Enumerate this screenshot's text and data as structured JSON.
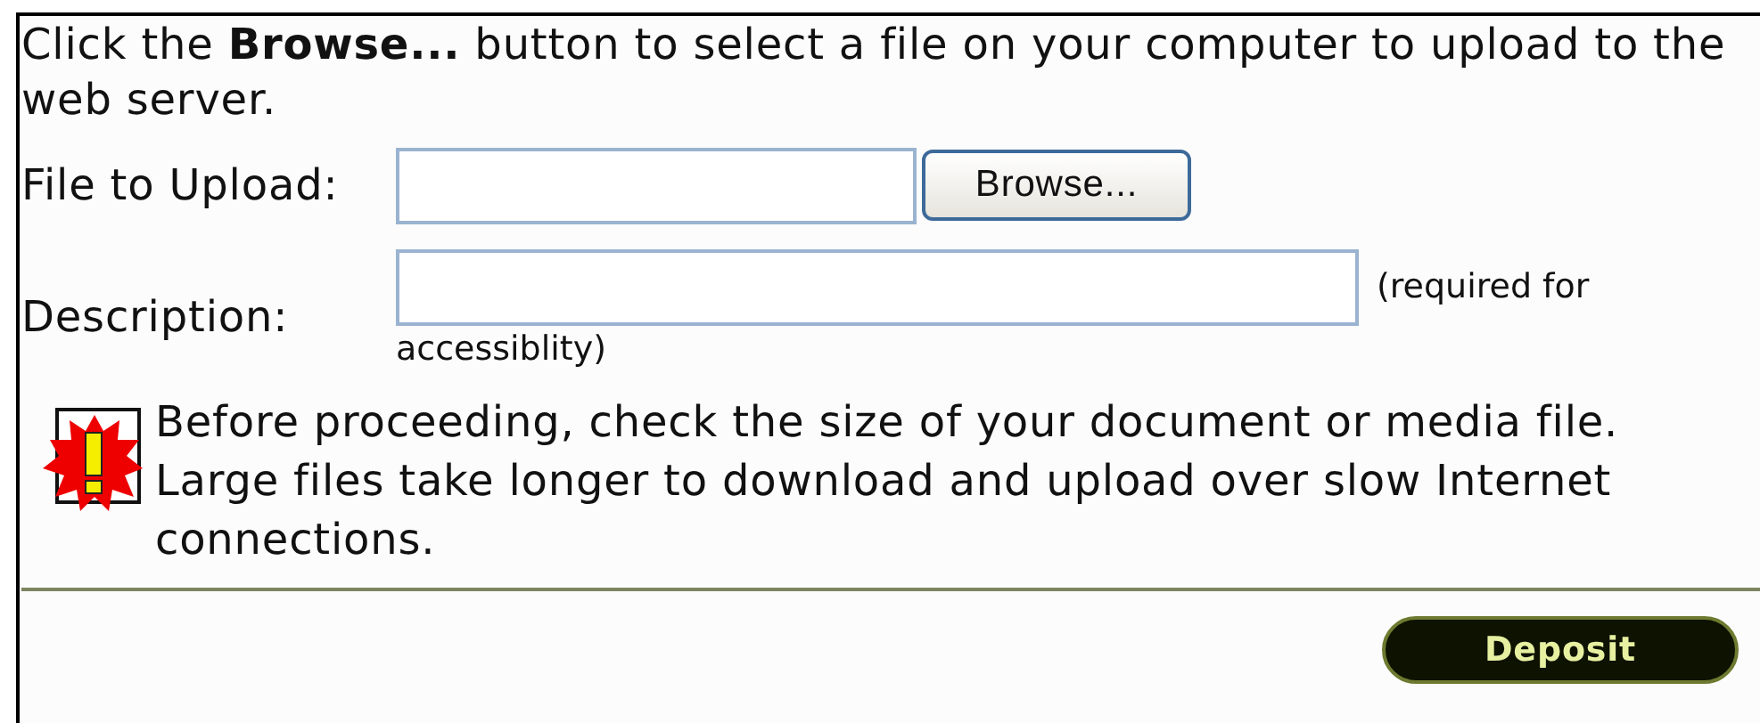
{
  "intro": "Click the **Browse...** button to select a file on your computer to upload to the web server.",
  "file_field": {
    "label": "File to Upload:",
    "browse_button": "Browse..."
  },
  "description_field": {
    "label": "Description:",
    "note_lines": [
      "(required for",
      "accessiblity)"
    ]
  },
  "warning": {
    "text": "Before proceeding, check the size of your document or media file. Large files take longer to download and upload over slow Internet connections."
  },
  "submit_button": "Deposit"
}
